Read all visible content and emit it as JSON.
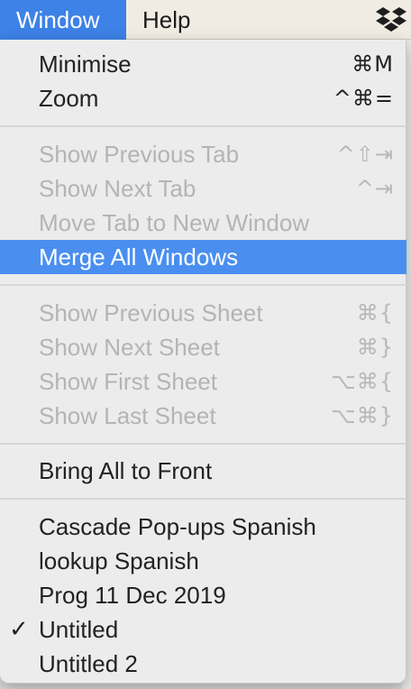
{
  "menubar": {
    "window_label": "Window",
    "help_label": "Help",
    "tray_icon": "dropbox-icon"
  },
  "menu": {
    "items": [
      {
        "label": "Minimise",
        "shortcut": "⌘M",
        "enabled": true
      },
      {
        "label": "Zoom",
        "shortcut": "^⌘=",
        "enabled": true
      },
      {
        "label": "Show Previous Tab",
        "shortcut": "^⇧⇥",
        "enabled": false
      },
      {
        "label": "Show Next Tab",
        "shortcut": "^⇥",
        "enabled": false
      },
      {
        "label": "Move Tab to New Window",
        "shortcut": "",
        "enabled": false
      },
      {
        "label": "Merge All Windows",
        "shortcut": "",
        "enabled": true,
        "highlighted": true
      },
      {
        "label": "Show Previous Sheet",
        "shortcut": "⌘{",
        "enabled": false
      },
      {
        "label": "Show Next Sheet",
        "shortcut": "⌘}",
        "enabled": false
      },
      {
        "label": "Show First Sheet",
        "shortcut": "⌥⌘{",
        "enabled": false
      },
      {
        "label": "Show Last Sheet",
        "shortcut": "⌥⌘}",
        "enabled": false
      },
      {
        "label": "Bring All to Front",
        "shortcut": "",
        "enabled": true
      },
      {
        "label": "Cascade Pop-ups Spanish",
        "shortcut": "",
        "enabled": true
      },
      {
        "label": "lookup Spanish",
        "shortcut": "",
        "enabled": true
      },
      {
        "label": "Prog 11 Dec 2019",
        "shortcut": "",
        "enabled": true
      },
      {
        "label": "Untitled",
        "shortcut": "",
        "enabled": true,
        "checked": true,
        "check_mark": "✓"
      },
      {
        "label": "Untitled 2",
        "shortcut": "",
        "enabled": true
      }
    ]
  },
  "colors": {
    "highlight": "#4a8ff0",
    "active_menubar": "#3d82e6",
    "disabled_text": "#b4b4b4"
  }
}
